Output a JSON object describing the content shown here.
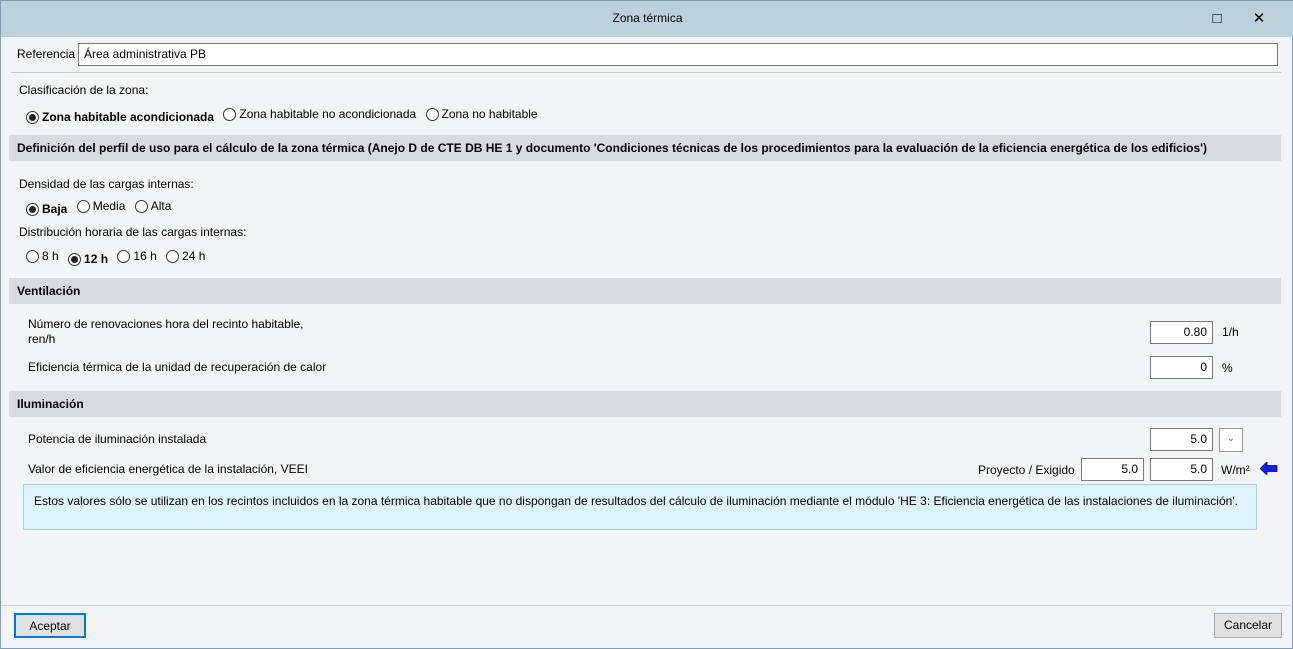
{
  "window": {
    "title": "Zona térmica",
    "maximize_icon": "□",
    "close_icon": "✕"
  },
  "referencia": {
    "label": "Referencia",
    "value": "Área administrativa PB"
  },
  "clasificacion": {
    "label": "Clasificación de la zona:",
    "options": [
      "Zona habitable acondicionada",
      "Zona habitable no acondicionada",
      "Zona no habitable"
    ],
    "selected": 0
  },
  "perfil": {
    "header": "Definición del perfil de uso para el cálculo de la zona térmica (Anejo D de CTE DB HE 1 y documento 'Condiciones técnicas de los procedimientos para la evaluación de la eficiencia energética de los edificios')",
    "densidad": {
      "label": "Densidad de las cargas internas:",
      "options": [
        "Baja",
        "Media",
        "Alta"
      ],
      "selected": 0
    },
    "distribucion": {
      "label": "Distribución horaria de las cargas internas:",
      "options": [
        "8 h",
        "12 h",
        "16 h",
        "24 h"
      ],
      "selected": 1
    }
  },
  "ventilacion": {
    "header": "Ventilación",
    "renovaciones": {
      "label1": "Número de renovaciones hora del recinto habitable,",
      "label2": "ren/h",
      "value": "0.80",
      "unit": "1/h"
    },
    "eficiencia": {
      "label": "Eficiencia térmica de la unidad de recuperación de calor",
      "value": "0",
      "unit": "%"
    }
  },
  "iluminacion": {
    "header": "Iluminación",
    "potencia": {
      "label": "Potencia de iluminación instalada",
      "value": "5.0"
    },
    "veei": {
      "label": "Valor de eficiencia energética de la instalación, VEEI",
      "sublabel": "Proyecto / Exigido",
      "proyecto": "5.0",
      "exigido": "5.0",
      "unit": "W/m²"
    },
    "info": "Estos valores sólo se utilizan en los recintos incluidos en la zona térmica habitable que no dispongan de resultados del cálculo de iluminación mediante el módulo 'HE 3: Eficiencia energética de las instalaciones de iluminación'."
  },
  "footer": {
    "accept": "Aceptar",
    "cancel": "Cancelar"
  },
  "colors": {
    "arrow": "#0a1ee8",
    "info_bg": "#def4fb"
  }
}
